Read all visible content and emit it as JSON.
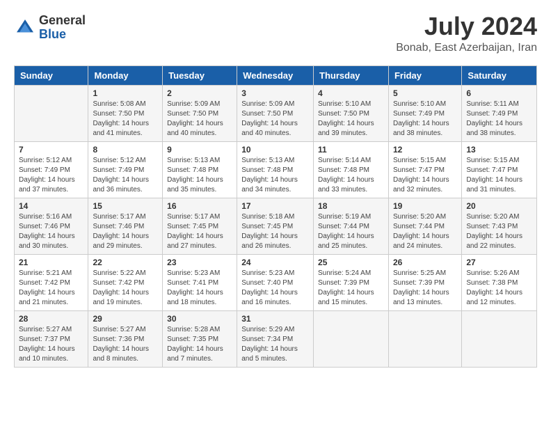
{
  "logo": {
    "general": "General",
    "blue": "Blue"
  },
  "title": {
    "month_year": "July 2024",
    "location": "Bonab, East Azerbaijan, Iran"
  },
  "days_of_week": [
    "Sunday",
    "Monday",
    "Tuesday",
    "Wednesday",
    "Thursday",
    "Friday",
    "Saturday"
  ],
  "weeks": [
    [
      {
        "day": "",
        "sunrise": "",
        "sunset": "",
        "daylight": ""
      },
      {
        "day": "1",
        "sunrise": "5:08 AM",
        "sunset": "7:50 PM",
        "daylight": "14 hours and 41 minutes."
      },
      {
        "day": "2",
        "sunrise": "5:09 AM",
        "sunset": "7:50 PM",
        "daylight": "14 hours and 40 minutes."
      },
      {
        "day": "3",
        "sunrise": "5:09 AM",
        "sunset": "7:50 PM",
        "daylight": "14 hours and 40 minutes."
      },
      {
        "day": "4",
        "sunrise": "5:10 AM",
        "sunset": "7:50 PM",
        "daylight": "14 hours and 39 minutes."
      },
      {
        "day": "5",
        "sunrise": "5:10 AM",
        "sunset": "7:49 PM",
        "daylight": "14 hours and 38 minutes."
      },
      {
        "day": "6",
        "sunrise": "5:11 AM",
        "sunset": "7:49 PM",
        "daylight": "14 hours and 38 minutes."
      }
    ],
    [
      {
        "day": "7",
        "sunrise": "5:12 AM",
        "sunset": "7:49 PM",
        "daylight": "14 hours and 37 minutes."
      },
      {
        "day": "8",
        "sunrise": "5:12 AM",
        "sunset": "7:49 PM",
        "daylight": "14 hours and 36 minutes."
      },
      {
        "day": "9",
        "sunrise": "5:13 AM",
        "sunset": "7:48 PM",
        "daylight": "14 hours and 35 minutes."
      },
      {
        "day": "10",
        "sunrise": "5:13 AM",
        "sunset": "7:48 PM",
        "daylight": "14 hours and 34 minutes."
      },
      {
        "day": "11",
        "sunrise": "5:14 AM",
        "sunset": "7:48 PM",
        "daylight": "14 hours and 33 minutes."
      },
      {
        "day": "12",
        "sunrise": "5:15 AM",
        "sunset": "7:47 PM",
        "daylight": "14 hours and 32 minutes."
      },
      {
        "day": "13",
        "sunrise": "5:15 AM",
        "sunset": "7:47 PM",
        "daylight": "14 hours and 31 minutes."
      }
    ],
    [
      {
        "day": "14",
        "sunrise": "5:16 AM",
        "sunset": "7:46 PM",
        "daylight": "14 hours and 30 minutes."
      },
      {
        "day": "15",
        "sunrise": "5:17 AM",
        "sunset": "7:46 PM",
        "daylight": "14 hours and 29 minutes."
      },
      {
        "day": "16",
        "sunrise": "5:17 AM",
        "sunset": "7:45 PM",
        "daylight": "14 hours and 27 minutes."
      },
      {
        "day": "17",
        "sunrise": "5:18 AM",
        "sunset": "7:45 PM",
        "daylight": "14 hours and 26 minutes."
      },
      {
        "day": "18",
        "sunrise": "5:19 AM",
        "sunset": "7:44 PM",
        "daylight": "14 hours and 25 minutes."
      },
      {
        "day": "19",
        "sunrise": "5:20 AM",
        "sunset": "7:44 PM",
        "daylight": "14 hours and 24 minutes."
      },
      {
        "day": "20",
        "sunrise": "5:20 AM",
        "sunset": "7:43 PM",
        "daylight": "14 hours and 22 minutes."
      }
    ],
    [
      {
        "day": "21",
        "sunrise": "5:21 AM",
        "sunset": "7:42 PM",
        "daylight": "14 hours and 21 minutes."
      },
      {
        "day": "22",
        "sunrise": "5:22 AM",
        "sunset": "7:42 PM",
        "daylight": "14 hours and 19 minutes."
      },
      {
        "day": "23",
        "sunrise": "5:23 AM",
        "sunset": "7:41 PM",
        "daylight": "14 hours and 18 minutes."
      },
      {
        "day": "24",
        "sunrise": "5:23 AM",
        "sunset": "7:40 PM",
        "daylight": "14 hours and 16 minutes."
      },
      {
        "day": "25",
        "sunrise": "5:24 AM",
        "sunset": "7:39 PM",
        "daylight": "14 hours and 15 minutes."
      },
      {
        "day": "26",
        "sunrise": "5:25 AM",
        "sunset": "7:39 PM",
        "daylight": "14 hours and 13 minutes."
      },
      {
        "day": "27",
        "sunrise": "5:26 AM",
        "sunset": "7:38 PM",
        "daylight": "14 hours and 12 minutes."
      }
    ],
    [
      {
        "day": "28",
        "sunrise": "5:27 AM",
        "sunset": "7:37 PM",
        "daylight": "14 hours and 10 minutes."
      },
      {
        "day": "29",
        "sunrise": "5:27 AM",
        "sunset": "7:36 PM",
        "daylight": "14 hours and 8 minutes."
      },
      {
        "day": "30",
        "sunrise": "5:28 AM",
        "sunset": "7:35 PM",
        "daylight": "14 hours and 7 minutes."
      },
      {
        "day": "31",
        "sunrise": "5:29 AM",
        "sunset": "7:34 PM",
        "daylight": "14 hours and 5 minutes."
      },
      {
        "day": "",
        "sunrise": "",
        "sunset": "",
        "daylight": ""
      },
      {
        "day": "",
        "sunrise": "",
        "sunset": "",
        "daylight": ""
      },
      {
        "day": "",
        "sunrise": "",
        "sunset": "",
        "daylight": ""
      }
    ]
  ]
}
